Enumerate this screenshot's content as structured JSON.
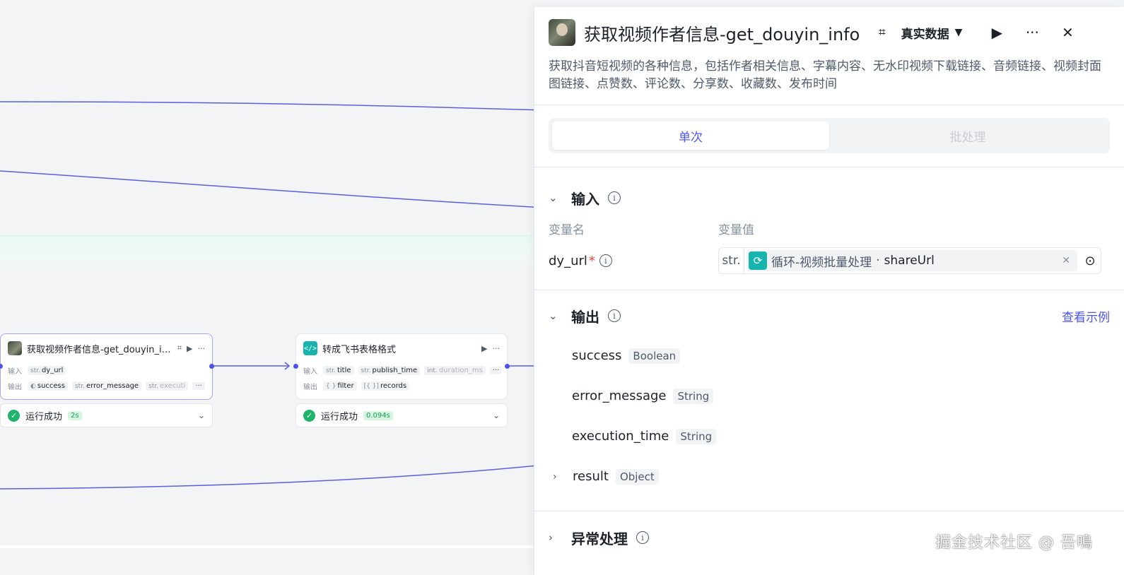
{
  "canvas": {
    "node1": {
      "title": "获取视频作者信息-get_douyin_info",
      "input_label": "输入",
      "output_label": "输出",
      "inputs": [
        {
          "type": "str.",
          "name": "dy_url"
        }
      ],
      "outputs": [
        {
          "type": "",
          "name": "success"
        },
        {
          "type": "str.",
          "name": "error_message"
        },
        {
          "type": "str.",
          "name": "executi"
        }
      ],
      "more": "···",
      "status_text": "运行成功",
      "time": "2s"
    },
    "node2": {
      "title": "转成飞书表格格式",
      "input_label": "输入",
      "output_label": "输出",
      "inputs": [
        {
          "type": "str.",
          "name": "title"
        },
        {
          "type": "str.",
          "name": "publish_time"
        },
        {
          "type": "int.",
          "name": "duration_ms"
        }
      ],
      "outputs": [
        {
          "type": "{ }",
          "name": "filter"
        },
        {
          "type": "[{ }]",
          "name": "records"
        }
      ],
      "more": "···",
      "status_text": "运行成功",
      "time": "0.094s"
    }
  },
  "panel": {
    "title": "获取视频作者信息-get_douyin_info",
    "data_mode": "真实数据",
    "more": "···",
    "close": "✕",
    "run": "▶",
    "description": "获取抖音短视频的各种信息，包括作者相关信息、字幕内容、无水印视频下载链接、音频链接、视频封面图链接、点赞数、评论数、分享数、收藏数、发布时间",
    "tabs": {
      "single": "单次",
      "batch": "批处理"
    },
    "input_section": {
      "title": "输入",
      "col_name": "变量名",
      "col_value": "变量值",
      "var_name": "dy_url",
      "required_mark": "*",
      "value_type": "str.",
      "ref_node": "循环-视频批量处理",
      "ref_sep": "·",
      "ref_field": "shareUrl"
    },
    "output_section": {
      "title": "输出",
      "link": "查看示例",
      "items": [
        {
          "name": "success",
          "type": "Boolean"
        },
        {
          "name": "error_message",
          "type": "String"
        },
        {
          "name": "execution_time",
          "type": "String"
        },
        {
          "name": "result",
          "type": "Object"
        }
      ]
    },
    "exception_section": {
      "title": "异常处理"
    }
  },
  "watermark": "掘金技术社区 @ 吾鳴",
  "colors": {
    "accent": "#4d53e8",
    "success": "#1eb46a",
    "teal": "#17b5ae"
  }
}
